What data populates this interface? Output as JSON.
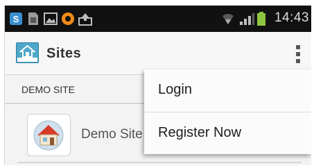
{
  "status_bar": {
    "time": "14:43",
    "icons": [
      "skype-icon",
      "sim-card-icon",
      "image-icon",
      "record-icon",
      "upload-icon",
      "wifi-icon",
      "signal-icon",
      "battery-icon"
    ]
  },
  "action_bar": {
    "title": "Sites",
    "overflow_icon": "overflow-menu-icon"
  },
  "list": {
    "section_header": "DEMO SITE",
    "items": [
      {
        "label": "Demo Site",
        "icon": "house-icon"
      }
    ]
  },
  "popup_menu": {
    "items": [
      {
        "label": "Login"
      },
      {
        "label": "Register Now"
      }
    ]
  },
  "colors": {
    "status_bar": "#111111",
    "action_bar": "#f7f7f7",
    "app_logo": "#4fa7c9",
    "battery": "#8ec63f"
  }
}
